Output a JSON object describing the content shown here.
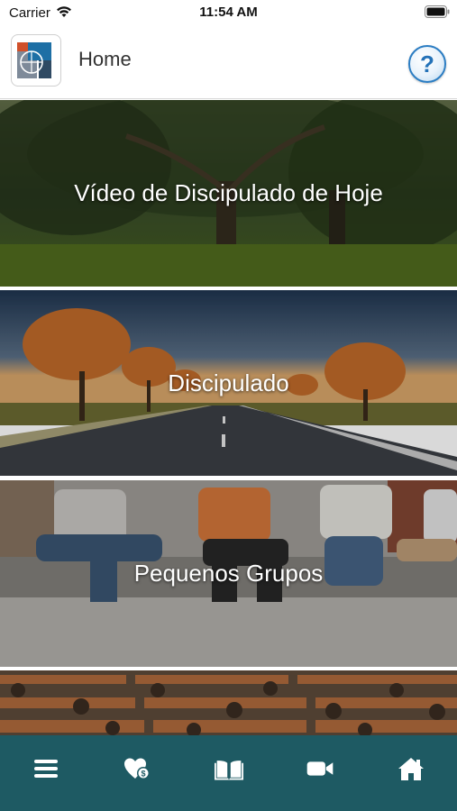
{
  "status_bar": {
    "carrier": "Carrier",
    "time": "11:54 AM",
    "wifi_icon": "wifi-icon",
    "battery_icon": "battery-icon"
  },
  "header": {
    "title": "Home",
    "logo_icon": "app-logo",
    "help_icon": "help-icon",
    "help_mark": "?"
  },
  "tiles": [
    {
      "label": "Vídeo de Discipulado de Hoje",
      "image": "forest-trees"
    },
    {
      "label": "Discipulado",
      "image": "road-with-trees-sunset"
    },
    {
      "label": "Pequenos Grupos",
      "image": "people-sitting-on-wall"
    },
    {
      "label": "",
      "image": "church-audience"
    }
  ],
  "tab_bar": {
    "background": "#1e5a63",
    "items": [
      {
        "icon": "menu-icon"
      },
      {
        "icon": "donate-heart-icon"
      },
      {
        "icon": "book-icon"
      },
      {
        "icon": "video-camera-icon"
      },
      {
        "icon": "home-icon"
      }
    ]
  }
}
